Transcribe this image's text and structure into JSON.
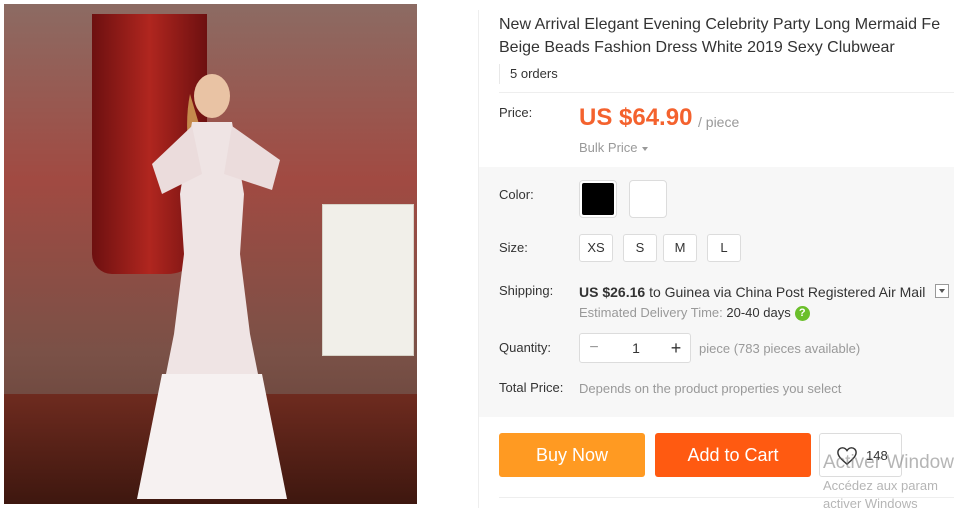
{
  "product": {
    "title_line1": "New Arrival Elegant Evening Celebrity Party Long Mermaid Fe",
    "title_line2": "Beige Beads Fashion Dress White 2019 Sexy Clubwear",
    "orders": "5 orders"
  },
  "price": {
    "label": "Price:",
    "value": "US $64.90",
    "unit": "/ piece",
    "bulk": "Bulk Price"
  },
  "color": {
    "label": "Color:",
    "options": [
      "#000000",
      "#ffffff"
    ]
  },
  "size": {
    "label": "Size:",
    "options": [
      "XS",
      "S",
      "M",
      "L"
    ]
  },
  "shipping": {
    "label": "Shipping:",
    "cost": "US $26.16",
    "destination": "to Guinea via China Post Registered Air Mail",
    "estimated_label": "Estimated Delivery Time:",
    "estimated_days": "20-40 days",
    "help_icon": "?"
  },
  "quantity": {
    "label": "Quantity:",
    "value": "1",
    "minus": "−",
    "plus": "+",
    "available": "piece (783 pieces available)"
  },
  "total": {
    "label": "Total Price:",
    "text": "Depends on the product properties you select"
  },
  "actions": {
    "buy_now": "Buy Now",
    "add_to_cart": "Add to Cart",
    "wishlist_count": "148"
  },
  "watermark": {
    "line1": "Activer Window",
    "line2": "Accédez aux param",
    "line3": "activer Windows"
  },
  "colors": {
    "accent_price": "#f4622e",
    "buy_now": "#ff9a22",
    "add_to_cart": "#ff5a11"
  }
}
